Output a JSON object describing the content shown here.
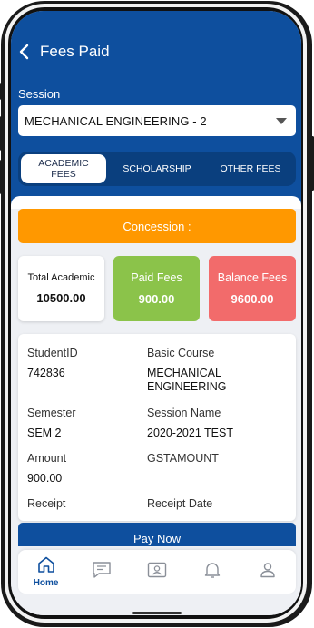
{
  "header": {
    "title": "Fees Paid",
    "session_label": "Session",
    "session_value": "MECHANICAL ENGINEERING - 2"
  },
  "tabs": [
    {
      "label": "ACADEMIC FEES",
      "active": true
    },
    {
      "label": "SCHOLARSHIP",
      "active": false
    },
    {
      "label": "OTHER FEES",
      "active": false
    }
  ],
  "concession": {
    "label": "Concession :"
  },
  "fees": {
    "total": {
      "label": "Total Academic",
      "value": "10500.00"
    },
    "paid": {
      "label": "Paid Fees",
      "value": "900.00"
    },
    "balance": {
      "label": "Balance Fees",
      "value": "9600.00"
    }
  },
  "details": {
    "student_id_label": "StudentID",
    "student_id_value": "742836",
    "basic_course_label": "Basic Course",
    "basic_course_value": "MECHANICAL ENGINEERING",
    "semester_label": "Semester",
    "semester_value": "SEM 2",
    "session_name_label": "Session Name",
    "session_name_value": "2020-2021 TEST",
    "amount_label": "Amount",
    "amount_value": "900.00",
    "gst_label": "GSTAMOUNT",
    "receipt_label": "Receipt",
    "receipt_date_label": "Receipt Date"
  },
  "pay_now_label": "Pay Now",
  "nav": {
    "home_label": "Home",
    "items": [
      "home-icon",
      "chat-icon",
      "id-card-icon",
      "bell-icon",
      "profile-icon"
    ]
  },
  "colors": {
    "primary": "#0e4f9e",
    "concession": "#ff9800",
    "paid": "#8bc34a",
    "balance": "#f26b6b"
  }
}
